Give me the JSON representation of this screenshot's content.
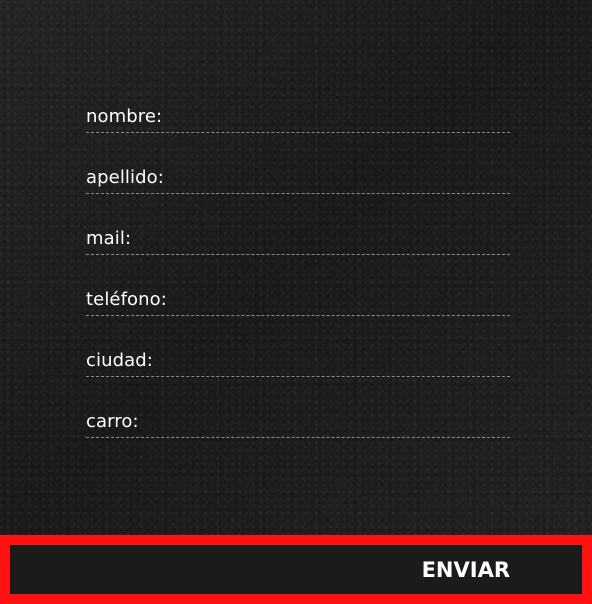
{
  "form": {
    "fields": [
      {
        "label": "nombre:",
        "value": ""
      },
      {
        "label": "apellido:",
        "value": ""
      },
      {
        "label": "mail:",
        "value": ""
      },
      {
        "label": "teléfono:",
        "value": ""
      },
      {
        "label": "ciudad:",
        "value": ""
      },
      {
        "label": "carro:",
        "value": ""
      }
    ],
    "submit_label": "ENVIAR"
  },
  "colors": {
    "accent": "#ff1111",
    "text": "#ffffff"
  }
}
